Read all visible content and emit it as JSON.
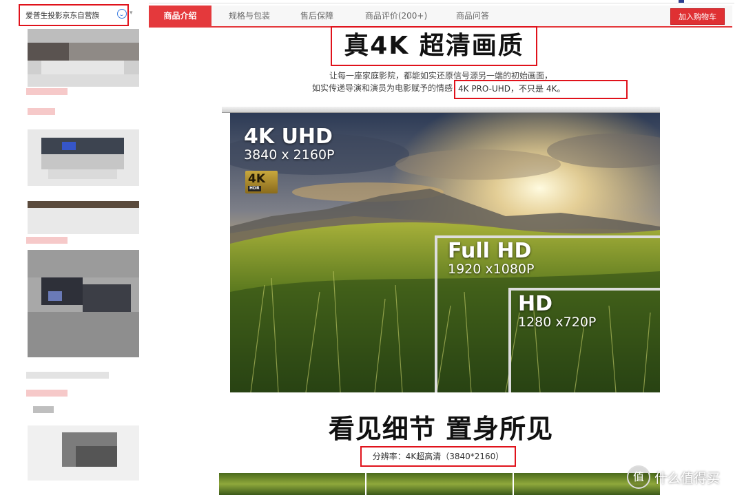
{
  "shop": {
    "name": "爱普生投影京东自营旗"
  },
  "tabs": [
    {
      "label": "商品介绍",
      "active": true
    },
    {
      "label": "规格与包装",
      "active": false
    },
    {
      "label": "售后保障",
      "active": false
    },
    {
      "label": "商品评价(200+)",
      "active": false
    },
    {
      "label": "商品问答",
      "active": false
    }
  ],
  "cart_button": "加入购物车",
  "content": {
    "headline": "真4K 超清画质",
    "desc_line1": "让每一座家庭影院，都能如实还原信号源另一端的初始画面，",
    "desc_line2": "如实传递导演和演员为电影赋予的情感",
    "desc_highlight": "4K PRO-UHD，不只是 4K。",
    "hero": {
      "uhd_title": "4K UHD",
      "uhd_res": "3840 x 2160P",
      "badge_big": "4K",
      "badge_small": "HDR",
      "fhd_title": "Full HD",
      "fhd_res": "1920 x1080P",
      "hd_title": "HD",
      "hd_res": "1280 x720P"
    },
    "headline2": "看见细节 置身所见",
    "resolution": "分辨率：4K超高清（3840*2160）"
  },
  "watermark": {
    "icon": "值",
    "text": "什么值得买"
  },
  "colors": {
    "accent": "#e4393c",
    "highlight_border": "#e0121b"
  }
}
